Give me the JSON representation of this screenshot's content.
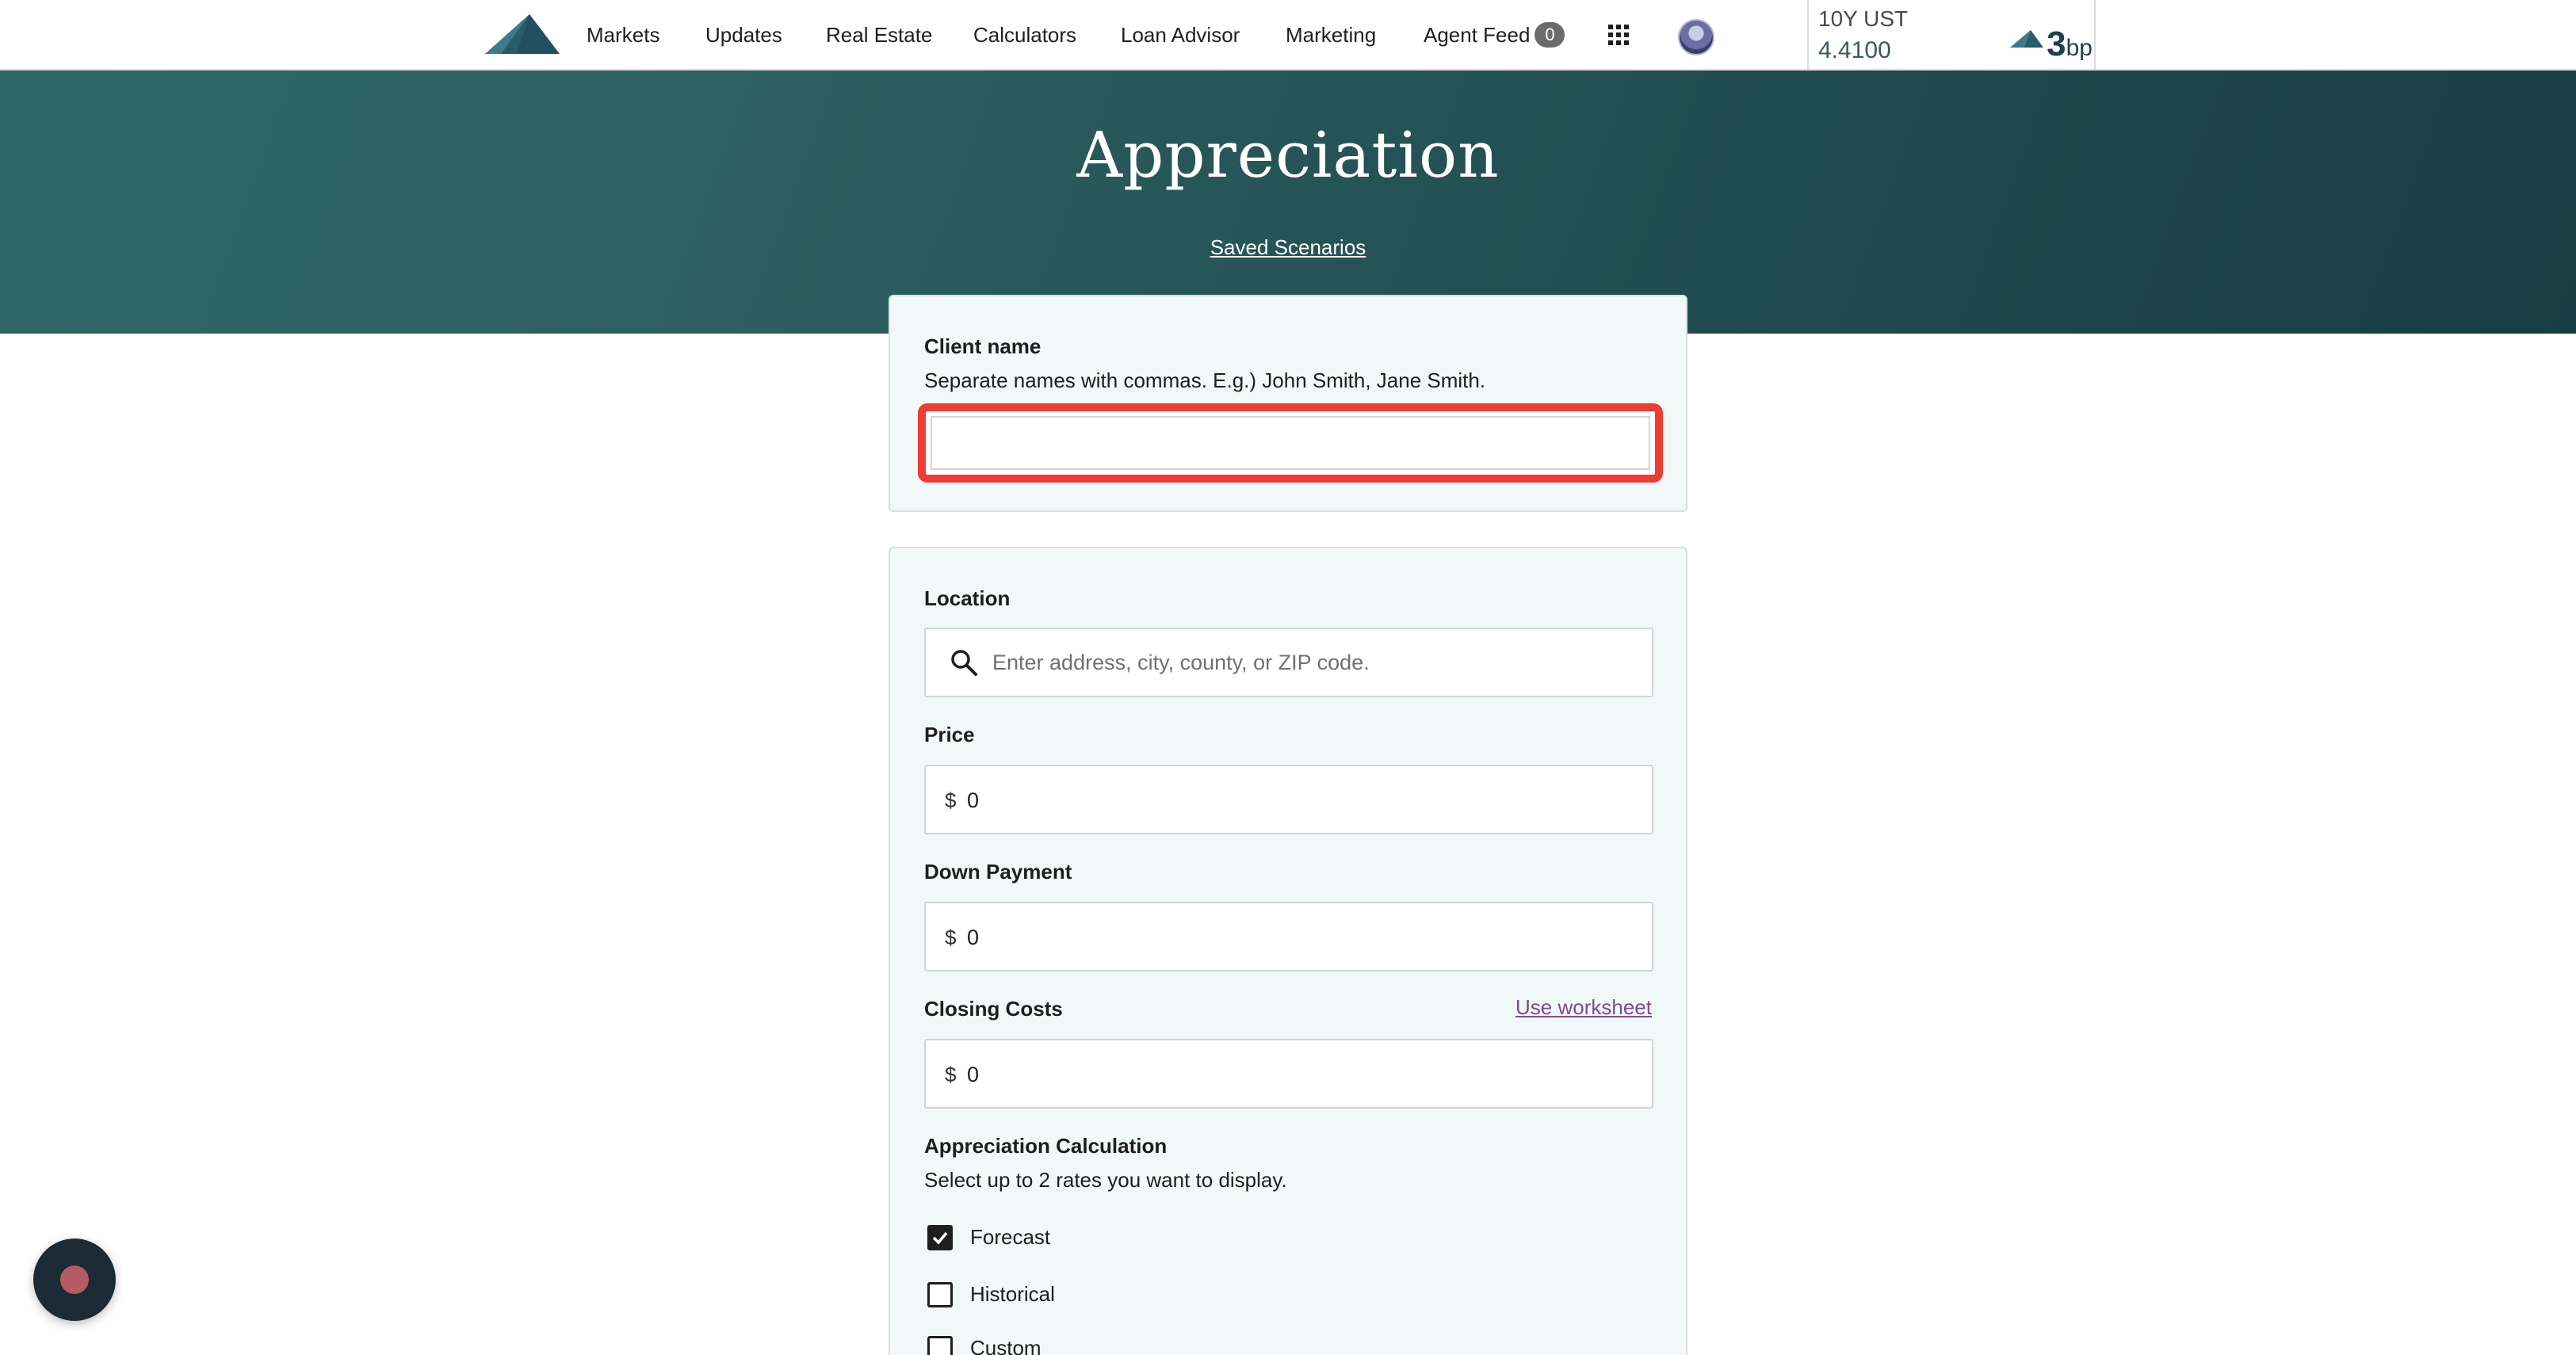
{
  "nav": {
    "links": [
      "Markets",
      "Updates",
      "Real Estate",
      "Calculators",
      "Loan Advisor",
      "Marketing",
      "Agent Feed"
    ],
    "agent_feed_count": "0",
    "icons": {
      "logo": "mountain-logo",
      "apps": "grid-icon",
      "avatar": "user-avatar"
    }
  },
  "ticker": {
    "name": "10Y UST",
    "value": "4.4100",
    "change": "3",
    "change_unit": "bp",
    "direction": "up"
  },
  "hero": {
    "title": "Appreciation",
    "saved_link": "Saved Scenarios"
  },
  "client": {
    "label": "Client name",
    "hint": "Separate names with commas. E.g.) John Smith, Jane Smith.",
    "value": ""
  },
  "form": {
    "location": {
      "label": "Location",
      "placeholder": "Enter address, city, county, or ZIP code.",
      "icon": "search-icon"
    },
    "price": {
      "label": "Price",
      "prefix": "$",
      "value": "0"
    },
    "down_payment": {
      "label": "Down Payment",
      "prefix": "$",
      "value": "0"
    },
    "closing_costs": {
      "label": "Closing Costs",
      "prefix": "$",
      "value": "0",
      "worksheet_link": "Use worksheet"
    },
    "appreciation": {
      "label": "Appreciation Calculation",
      "hint": "Select up to 2 rates you want to display.",
      "options": [
        {
          "label": "Forecast",
          "checked": true
        },
        {
          "label": "Historical",
          "checked": false
        },
        {
          "label": "Custom",
          "checked": false
        }
      ]
    }
  },
  "colors": {
    "hero_start": "#2f6666",
    "hero_end": "#173d42",
    "highlight_ring": "#ee3b33",
    "link_purple": "#7a4e8f",
    "card_bg": "#f2f7f7"
  }
}
